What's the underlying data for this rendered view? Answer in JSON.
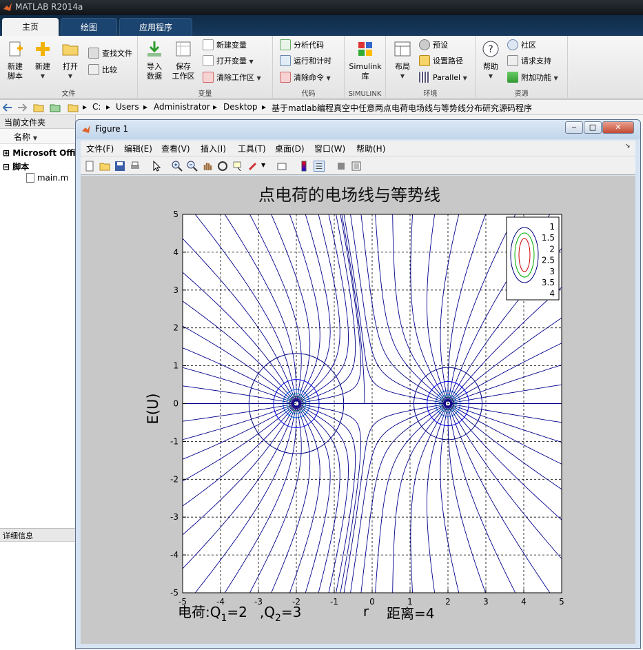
{
  "app": {
    "title": "MATLAB R2014a"
  },
  "tabs": [
    "主页",
    "绘图",
    "应用程序"
  ],
  "ribbon": {
    "file": {
      "title": "文件",
      "new_script": "新建\n脚本",
      "new": "新建",
      "open": "打开",
      "find_files": "查找文件",
      "compare": "比较"
    },
    "variable": {
      "title": "变量",
      "import": "导入\n数据",
      "save": "保存\n工作区",
      "new_var": "新建变量",
      "open_var": "打开变量",
      "clear_ws": "清除工作区"
    },
    "code": {
      "title": "代码",
      "analyze": "分析代码",
      "run_time": "运行和计时",
      "clear_cmd": "清除命令"
    },
    "simulink": {
      "title": "SIMULINK",
      "lib": "Simulink\n库"
    },
    "env": {
      "title": "环境",
      "layout": "布局",
      "prefs": "预设",
      "set_path": "设置路径",
      "parallel": "Parallel"
    },
    "resources": {
      "title": "资源",
      "help": "帮助",
      "community": "社区",
      "support": "请求支持",
      "addons": "附加功能"
    }
  },
  "address": [
    "C:",
    "Users",
    "Administrator",
    "Desktop",
    "基于matlab编程真空中任意两点电荷电场线与等势线分布研究源码程序"
  ],
  "left_panel": {
    "title": "当前文件夹",
    "column": "名称",
    "items": [
      "Microsoft Offic",
      "脚本",
      "main.m"
    ],
    "details": "详细信息"
  },
  "figure": {
    "window_title": "Figure 1",
    "menu": [
      "文件(F)",
      "编辑(E)",
      "查看(V)",
      "插入(I)",
      "工具(T)",
      "桌面(D)",
      "窗口(W)",
      "帮助(H)"
    ],
    "buttons": {
      "minimize": "‒",
      "maximize": "□",
      "close": "✕"
    }
  },
  "chart_data": {
    "type": "line",
    "title": "点电荷的电场线与等势线",
    "ylabel": "E(U)",
    "xlabel": "r",
    "xlim": [
      -5,
      5
    ],
    "ylim": [
      -5,
      5
    ],
    "xticks": [
      -5,
      -4,
      -3,
      -2,
      -1,
      0,
      1,
      2,
      3,
      4,
      5
    ],
    "yticks": [
      -5,
      -4,
      -3,
      -2,
      -1,
      0,
      1,
      2,
      3,
      4,
      5
    ],
    "grid": true,
    "legend_position": "top-right",
    "charges": [
      {
        "x": -2,
        "y": 0,
        "q": 2
      },
      {
        "x": 2,
        "y": 0,
        "q": 3
      }
    ],
    "equipotential_levels": [
      "1",
      "1.5",
      "2",
      "2.5",
      "3",
      "3.5",
      "4"
    ],
    "level_colors": [
      "#00007f",
      "#0000ff",
      "#007fff",
      "#00cccc",
      "#00aa00",
      "#cc0000",
      "#7f0000"
    ],
    "field_line_color": "#00008b",
    "annotation_charge": {
      "prefix": "电荷:Q",
      "sub1": "1",
      "mid": "=2",
      "sep": ",Q",
      "sub2": "2",
      "tail": "=3"
    },
    "annotation_distance": "距离=4"
  }
}
